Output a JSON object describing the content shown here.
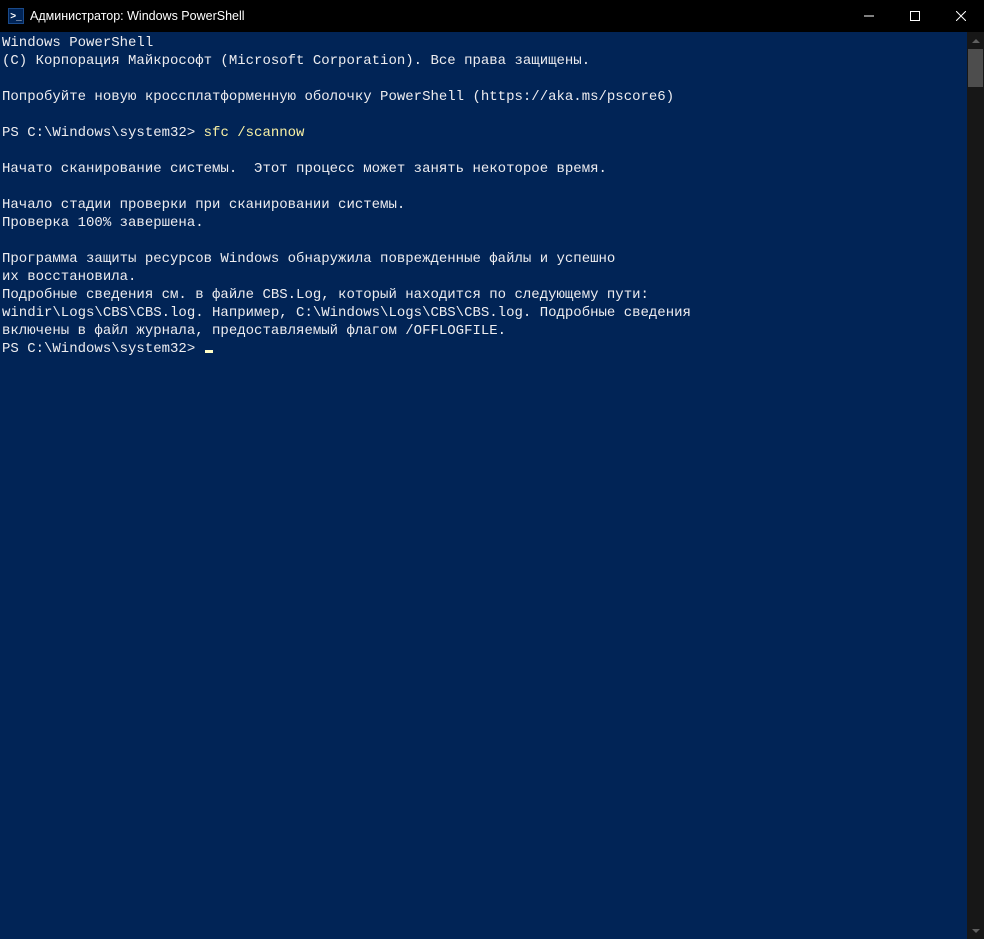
{
  "window": {
    "title": "Администратор: Windows PowerShell",
    "icon_glyph": ">_"
  },
  "terminal": {
    "lines": [
      {
        "t": "plain",
        "text": "Windows PowerShell"
      },
      {
        "t": "plain",
        "text": "(C) Корпорация Майкрософт (Microsoft Corporation). Все права защищены."
      },
      {
        "t": "blank"
      },
      {
        "t": "plain",
        "text": "Попробуйте новую кроссплатформенную оболочку PowerShell (https://aka.ms/pscore6)"
      },
      {
        "t": "blank"
      },
      {
        "t": "prompt",
        "prompt": "PS C:\\Windows\\system32> ",
        "cmd": "sfc /scannow"
      },
      {
        "t": "blank"
      },
      {
        "t": "plain",
        "text": "Начато сканирование системы.  Этот процесс может занять некоторое время."
      },
      {
        "t": "blank"
      },
      {
        "t": "plain",
        "text": "Начало стадии проверки при сканировании системы."
      },
      {
        "t": "plain",
        "text": "Проверка 100% завершена."
      },
      {
        "t": "blank"
      },
      {
        "t": "plain",
        "text": "Программа защиты ресурсов Windows обнаружила поврежденные файлы и успешно"
      },
      {
        "t": "plain",
        "text": "их восстановила."
      },
      {
        "t": "plain",
        "text": "Подробные сведения см. в файле CBS.Log, который находится по следующему пути:"
      },
      {
        "t": "plain",
        "text": "windir\\Logs\\CBS\\CBS.log. Например, C:\\Windows\\Logs\\CBS\\CBS.log. Подробные сведения"
      },
      {
        "t": "plain",
        "text": "включены в файл журнала, предоставляемый флагом /OFFLOGFILE."
      },
      {
        "t": "prompt-cursor",
        "prompt": "PS C:\\Windows\\system32> "
      }
    ]
  }
}
